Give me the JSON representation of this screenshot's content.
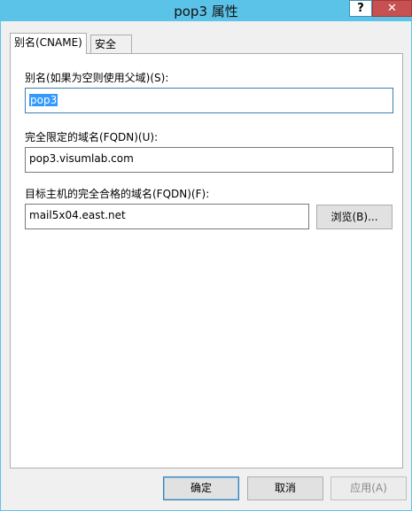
{
  "window": {
    "title": "pop3 属性",
    "help_label": "?",
    "close_label": "✕"
  },
  "tabs": [
    {
      "label": "别名(CNAME)",
      "active": true
    },
    {
      "label": "安全",
      "active": false
    }
  ],
  "form": {
    "alias_label": "别名(如果为空则使用父域)(S):",
    "alias_value": "pop3",
    "fqdn_label": "完全限定的域名(FQDN)(U):",
    "fqdn_value": "pop3.visumlab.com",
    "target_label": "目标主机的完全合格的域名(FQDN)(F):",
    "target_value": "mail5x04.east.net",
    "browse_label": "浏览(B)..."
  },
  "footer": {
    "ok_label": "确定",
    "cancel_label": "取消",
    "apply_label": "应用(A)"
  },
  "colors": {
    "titlebar": "#5cc3e8",
    "close_button": "#c75050",
    "selection": "#3399ff"
  }
}
